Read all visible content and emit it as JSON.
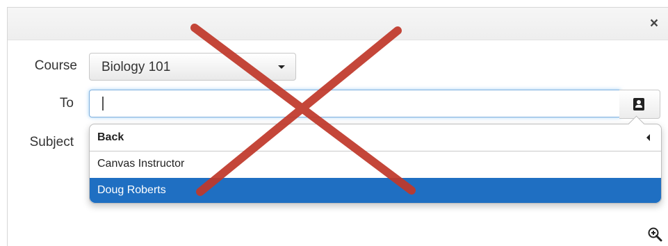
{
  "dialog": {
    "close_label": "×"
  },
  "form": {
    "course_label": "Course",
    "course_value": "Biology 101",
    "to_label": "To",
    "subject_label": "Subject"
  },
  "recipients_menu": {
    "back_label": "Back",
    "items": [
      {
        "label": "Canvas Instructor",
        "selected": false
      },
      {
        "label": "Doug Roberts",
        "selected": true
      }
    ]
  },
  "overlay": {
    "mark": "red-x",
    "color": "#c0392b"
  },
  "colors": {
    "selected_bg": "#1f6fc2",
    "focus_border": "#7fb0de"
  },
  "icons": [
    "close-icon",
    "caret-down-icon",
    "address-book-icon",
    "chevron-left-icon",
    "zoom-in-icon"
  ]
}
